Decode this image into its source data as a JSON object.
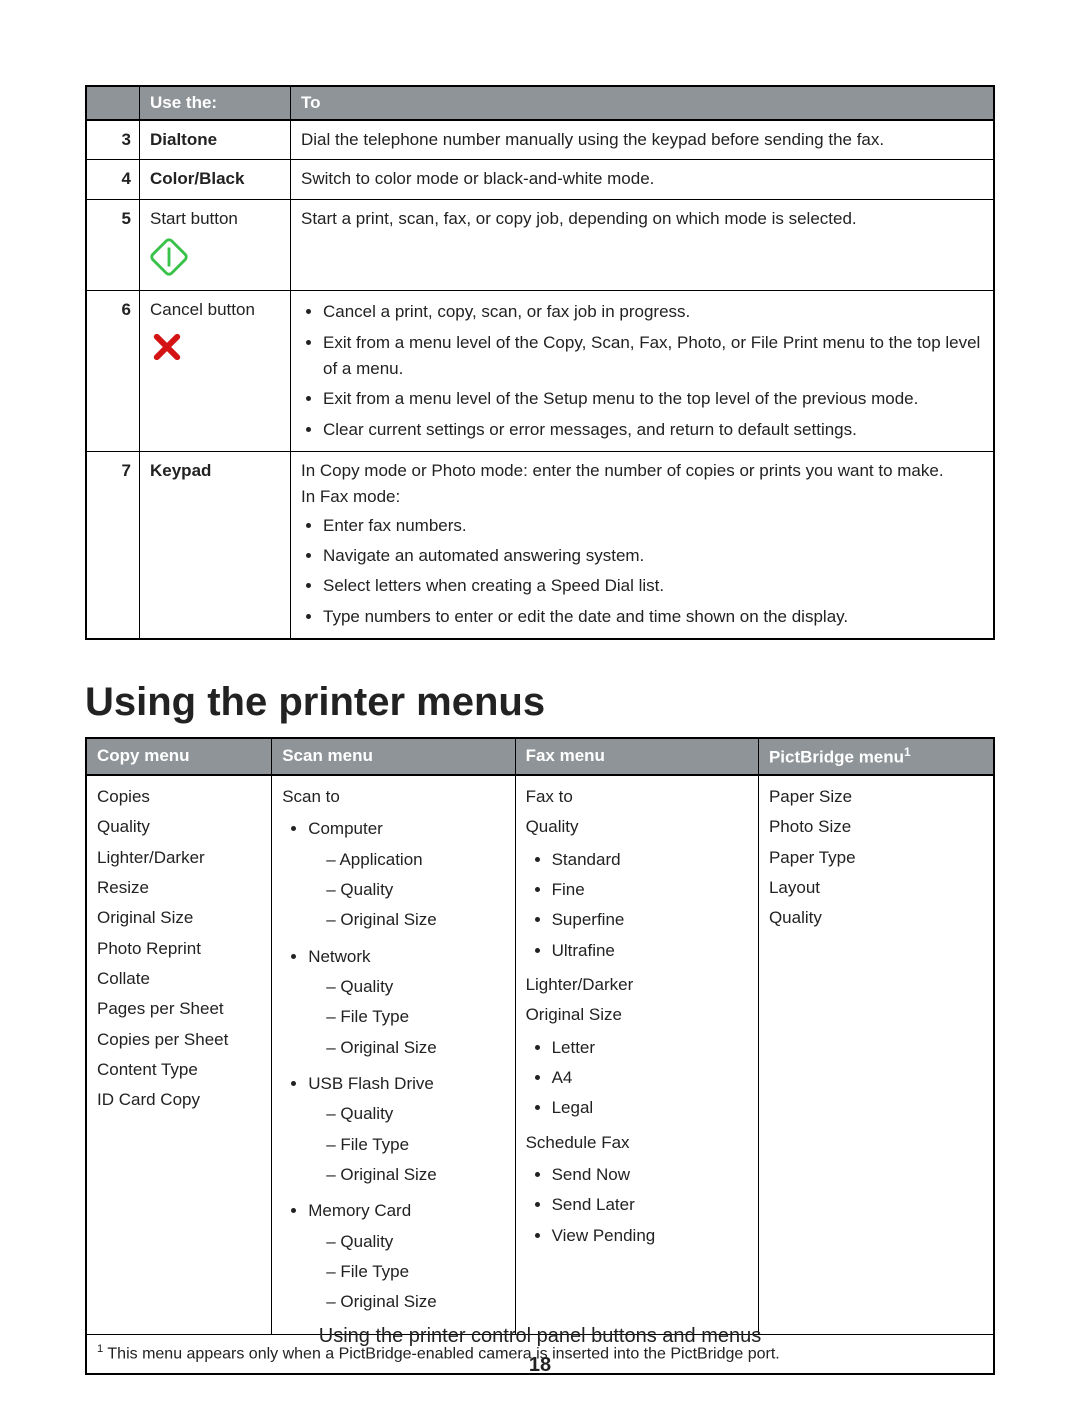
{
  "buttons_table": {
    "headers": {
      "num": "",
      "use": "Use the:",
      "to": "To"
    },
    "rows": [
      {
        "num": "3",
        "name": "Dialtone",
        "bold": true,
        "desc": "Dial the telephone number manually using the keypad before sending the fax."
      },
      {
        "num": "4",
        "name": "Color/Black",
        "bold": true,
        "desc": "Switch to color mode or black-and-white mode."
      },
      {
        "num": "5",
        "name": "Start button",
        "bold": false,
        "icon": "start",
        "desc": "Start a print, scan, fax, or copy job, depending on which mode is selected."
      },
      {
        "num": "6",
        "name": "Cancel button",
        "bold": false,
        "icon": "cancel",
        "bullets": [
          "Cancel a print, copy, scan, or fax job in progress.",
          "Exit from a menu level of the Copy, Scan, Fax, Photo, or File Print menu to the top level of a menu.",
          "Exit from a menu level of the Setup menu to the top level of the previous mode.",
          "Clear current settings or error messages, and return to default settings."
        ]
      },
      {
        "num": "7",
        "name": "Keypad",
        "bold": true,
        "desc": "In Copy mode or Photo mode: enter the number of copies or prints you want to make.",
        "subhead": "In Fax mode:",
        "bullets": [
          "Enter fax numbers.",
          "Navigate an automated answering system.",
          "Select letters when creating a Speed Dial list.",
          "Type numbers to enter or edit the date and time shown on the display."
        ]
      }
    ]
  },
  "section_heading": "Using the printer menus",
  "menus_table": {
    "headers": {
      "copy": "Copy menu",
      "scan": "Scan menu",
      "fax": "Fax menu",
      "pict": "PictBridge menu",
      "pict_sup": "1"
    },
    "copy_items": [
      "Copies",
      "Quality",
      "Lighter/Darker",
      "Resize",
      "Original Size",
      "Photo Reprint",
      "Collate",
      "Pages per Sheet",
      "Copies per Sheet",
      "Content Type",
      "ID Card Copy"
    ],
    "scan": {
      "top": "Scan to",
      "groups": [
        {
          "label": "Computer",
          "subs": [
            "Application",
            "Quality",
            "Original Size"
          ]
        },
        {
          "label": "Network",
          "subs": [
            "Quality",
            "File Type",
            "Original Size"
          ]
        },
        {
          "label": "USB Flash Drive",
          "subs": [
            "Quality",
            "File Type",
            "Original Size"
          ]
        },
        {
          "label": "Memory Card",
          "subs": [
            "Quality",
            "File Type",
            "Original Size"
          ]
        }
      ]
    },
    "fax": {
      "items": [
        {
          "label": "Fax to"
        },
        {
          "label": "Quality",
          "subs": [
            "Standard",
            "Fine",
            "Superfine",
            "Ultrafine"
          ]
        },
        {
          "label": "Lighter/Darker"
        },
        {
          "label": "Original Size",
          "subs": [
            "Letter",
            "A4",
            "Legal"
          ]
        },
        {
          "label": "Schedule Fax",
          "subs": [
            "Send Now",
            "Send Later",
            "View Pending"
          ]
        }
      ]
    },
    "pict_items": [
      "Paper Size",
      "Photo Size",
      "Paper Type",
      "Layout",
      "Quality"
    ],
    "footnote_sup": "1",
    "footnote": " This menu appears only when a PictBridge-enabled camera is inserted into the PictBridge port."
  },
  "footer": {
    "title": "Using the printer control panel buttons and menus",
    "page": "18"
  }
}
